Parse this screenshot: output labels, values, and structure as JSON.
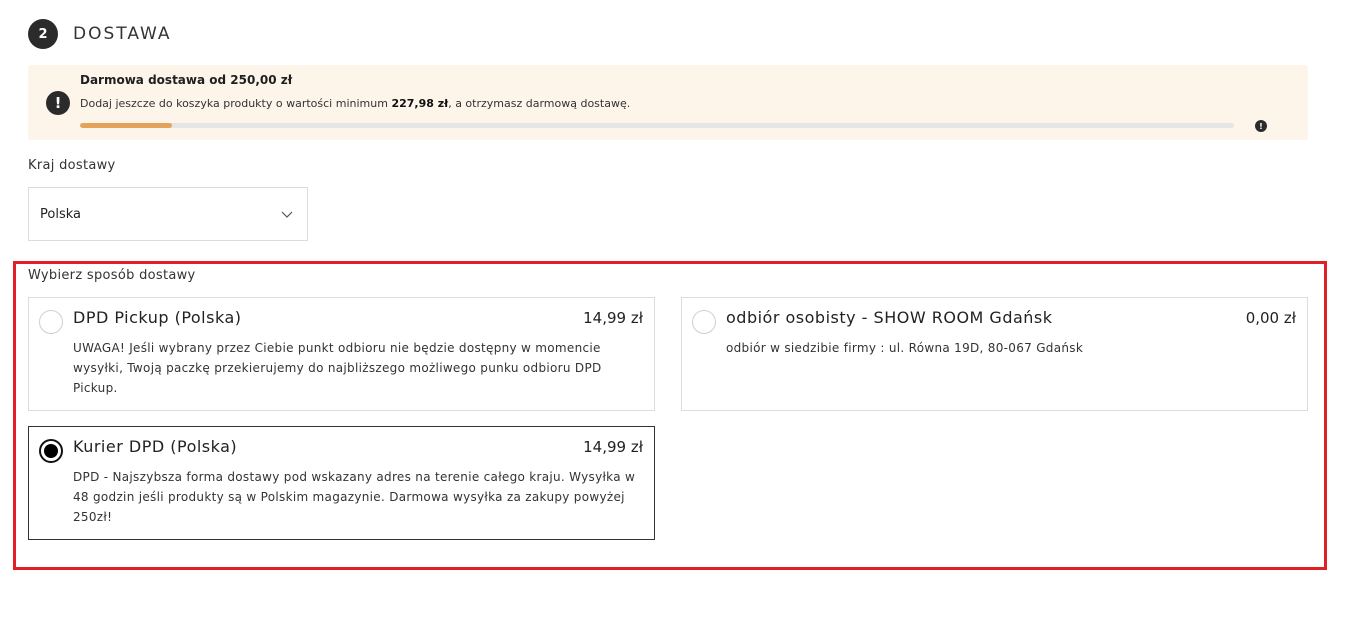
{
  "step": {
    "number": "2",
    "title": "DOSTAWA"
  },
  "banner": {
    "title": "Darmowa dostawa od 250,00  zł",
    "text_before": "Dodaj jeszcze do koszyka produkty o wartości minimum ",
    "amount": "227,98  zł",
    "text_after": ", a otrzymasz darmową dostawę.",
    "progress_fraction": 0.08,
    "progress_color": "#e3a35a",
    "icon": "exclamation-circle-icon"
  },
  "country": {
    "label": "Kraj dostawy",
    "selected": "Polska"
  },
  "shipping": {
    "label": "Wybierz sposób dostawy",
    "options": [
      {
        "name": "DPD Pickup (Polska)",
        "price": "14,99 zł",
        "description": "UWAGA! Jeśli wybrany przez Ciebie punkt odbioru nie będzie dostępny w momencie wysyłki, Twoją paczkę przekierujemy do najbliższego możliwego punku odbioru DPD Pickup.",
        "selected": false
      },
      {
        "name": "odbiór osobisty - SHOW ROOM Gdańsk",
        "price": "0,00 zł",
        "description": "odbiór w siedzibie firmy : ul. Równa 19D, 80-067 Gdańsk",
        "selected": false
      },
      {
        "name": "Kurier DPD (Polska)",
        "price": "14,99 zł",
        "description": "DPD - Najszybsza forma dostawy pod wskazany adres na terenie całego kraju. Wysyłka w 48 godzin jeśli produkty są w Polskim magazynie. Darmowa wysyłka za zakupy powyżej 250zł!",
        "selected": true
      }
    ]
  },
  "highlight_color": "#e01f27"
}
